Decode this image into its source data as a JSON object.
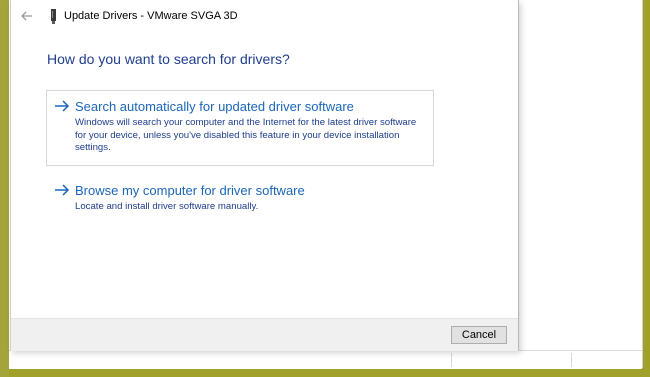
{
  "dialog": {
    "title": "Update Drivers - VMware SVGA 3D",
    "heading": "How do you want to search for drivers?",
    "options": [
      {
        "title": "Search automatically for updated driver software",
        "description": "Windows will search your computer and the Internet for the latest driver software for your device, unless you've disabled this feature in your device installation settings."
      },
      {
        "title": "Browse my computer for driver software",
        "description": "Locate and install driver software manually."
      }
    ],
    "cancel_label": "Cancel"
  },
  "icons": {
    "back": "back-arrow-icon",
    "device": "device-icon",
    "option_arrow": "arrow-right-icon"
  },
  "colors": {
    "heading": "#1e3d8c",
    "link": "#1c66b8",
    "background_desktop": "#9fa12b",
    "footer": "#f0f0f0"
  }
}
